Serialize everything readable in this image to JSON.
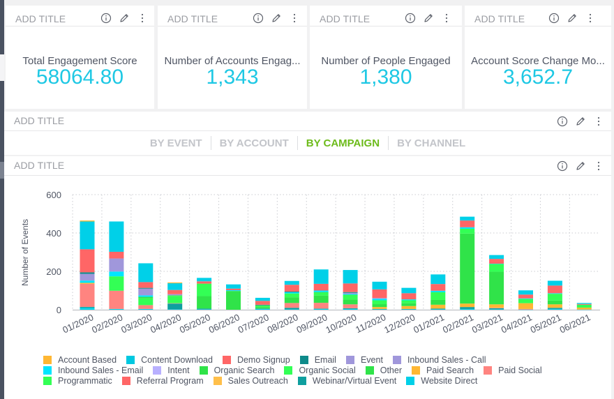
{
  "kpi_cards": [
    {
      "header_title": "ADD TITLE",
      "label": "Total Engagement Score",
      "value": "58064.80"
    },
    {
      "header_title": "ADD TITLE",
      "label": "Number of Accounts Engag...",
      "value": "1,343"
    },
    {
      "header_title": "ADD TITLE",
      "label": "Number of People Engaged",
      "value": "1,380"
    },
    {
      "header_title": "ADD TITLE",
      "label": "Account Score Change Mo...",
      "value": "3,652.7"
    }
  ],
  "tabs_card": {
    "header_title": "ADD TITLE",
    "tabs": [
      {
        "label": "BY EVENT",
        "active": false
      },
      {
        "label": "BY ACCOUNT",
        "active": false
      },
      {
        "label": "BY CAMPAIGN",
        "active": true
      },
      {
        "label": "BY CHANNEL",
        "active": false
      }
    ]
  },
  "chart_card": {
    "header_title": "ADD TITLE"
  },
  "icons": {
    "info": "info-icon",
    "edit": "pencil-icon",
    "more": "more-vertical-icon"
  },
  "colors": {
    "accent_value": "#1ec8e4",
    "active_tab": "#6dbb1b"
  },
  "chart_data": {
    "type": "bar",
    "stacked": true,
    "title": "",
    "xlabel": "",
    "ylabel": "Number of Events",
    "ylim": [
      0,
      600
    ],
    "yticks": [
      0,
      200,
      400,
      600
    ],
    "grid": true,
    "legend_position": "bottom",
    "categories": [
      "01/2020",
      "02/2020",
      "03/2020",
      "04/2020",
      "05/2020",
      "06/2020",
      "07/2020",
      "08/2020",
      "09/2020",
      "10/2020",
      "11/2020",
      "12/2020",
      "01/2021",
      "02/2021",
      "03/2021",
      "04/2021",
      "05/2021",
      "06/2021"
    ],
    "series": [
      {
        "name": "Website Direct",
        "color": "#00d0e8",
        "values": [
          10,
          4,
          4,
          2,
          2,
          0,
          4,
          2,
          4,
          4,
          2,
          2,
          2,
          4,
          2,
          1,
          4,
          1
        ]
      },
      {
        "name": "Webinar/Virtual Event",
        "color": "#0f9f9f",
        "values": [
          5,
          0,
          0,
          30,
          4,
          0,
          2,
          8,
          2,
          4,
          2,
          2,
          4,
          10,
          6,
          0,
          6,
          0
        ]
      },
      {
        "name": "Paid Social",
        "color": "#ff8480",
        "values": [
          120,
          95,
          20,
          2,
          0,
          0,
          0,
          25,
          30,
          20,
          0,
          0,
          0,
          0,
          2,
          3,
          0,
          0
        ]
      },
      {
        "name": "Paid Search",
        "color": "#ffb733",
        "values": [
          5,
          0,
          0,
          0,
          0,
          0,
          0,
          0,
          0,
          0,
          10,
          15,
          20,
          18,
          18,
          30,
          18,
          10
        ]
      },
      {
        "name": "Other",
        "color": "#30e349",
        "values": [
          0,
          0,
          0,
          0,
          65,
          95,
          8,
          30,
          38,
          25,
          15,
          15,
          25,
          365,
          170,
          0,
          20,
          0
        ]
      },
      {
        "name": "Organic Social",
        "color": "#33ff55",
        "values": [
          0,
          75,
          35,
          38,
          65,
          0,
          5,
          20,
          15,
          25,
          20,
          15,
          40,
          25,
          40,
          22,
          35,
          15
        ]
      },
      {
        "name": "Organic Search",
        "color": "#30e349",
        "values": [
          0,
          0,
          8,
          3,
          0,
          3,
          4,
          0,
          3,
          0,
          0,
          0,
          0,
          0,
          0,
          0,
          0,
          0
        ]
      },
      {
        "name": "Inbound Sales - Email",
        "color": "#00e5ff",
        "values": [
          12,
          25,
          8,
          0,
          0,
          4,
          0,
          6,
          8,
          4,
          8,
          5,
          8,
          8,
          2,
          3,
          3,
          0
        ]
      },
      {
        "name": "Event",
        "color": "#a097db",
        "values": [
          35,
          68,
          35,
          6,
          0,
          0,
          0,
          0,
          0,
          6,
          4,
          0,
          0,
          0,
          0,
          0,
          0,
          0
        ]
      },
      {
        "name": "Email",
        "color": "#0e8a8a",
        "values": [
          8,
          0,
          4,
          0,
          0,
          0,
          3,
          4,
          0,
          4,
          0,
          0,
          0,
          0,
          0,
          0,
          0,
          0
        ]
      },
      {
        "name": "Demo Signup",
        "color": "#ff6666",
        "values": [
          120,
          35,
          30,
          22,
          12,
          8,
          20,
          35,
          35,
          45,
          45,
          32,
          35,
          35,
          25,
          20,
          40,
          4
        ]
      },
      {
        "name": "Content Download",
        "color": "#00d0e8",
        "values": [
          145,
          158,
          98,
          35,
          18,
          22,
          16,
          20,
          75,
          70,
          40,
          28,
          50,
          20,
          20,
          22,
          25,
          5
        ]
      },
      {
        "name": "Account Based",
        "color": "#ffb733",
        "values": [
          5,
          0,
          0,
          4,
          0,
          0,
          0,
          0,
          0,
          0,
          0,
          0,
          0,
          0,
          0,
          0,
          0,
          0
        ]
      }
    ],
    "legend": [
      {
        "name": "Account Based",
        "color": "#ffb733"
      },
      {
        "name": "Content Download",
        "color": "#00c8e0"
      },
      {
        "name": "Demo Signup",
        "color": "#ff6666"
      },
      {
        "name": "Email",
        "color": "#0e8a8a"
      },
      {
        "name": "Event",
        "color": "#a097db"
      },
      {
        "name": "Inbound Sales - Call",
        "color": "#a097db"
      },
      {
        "name": "Inbound Sales - Email",
        "color": "#00e5ff"
      },
      {
        "name": "Intent",
        "color": "#b8b0ff"
      },
      {
        "name": "Organic Search",
        "color": "#30e349"
      },
      {
        "name": "Organic Social",
        "color": "#33ff55"
      },
      {
        "name": "Other",
        "color": "#30e349"
      },
      {
        "name": "Paid Search",
        "color": "#ffb733"
      },
      {
        "name": "Paid Social",
        "color": "#ff8480"
      },
      {
        "name": "Programmatic",
        "color": "#33ff55"
      },
      {
        "name": "Referral Program",
        "color": "#ff6666"
      },
      {
        "name": "Sales Outreach",
        "color": "#ffbf4a"
      },
      {
        "name": "Webinar/Virtual Event",
        "color": "#0f9f9f"
      },
      {
        "name": "Website Direct",
        "color": "#00d0e8"
      }
    ]
  }
}
